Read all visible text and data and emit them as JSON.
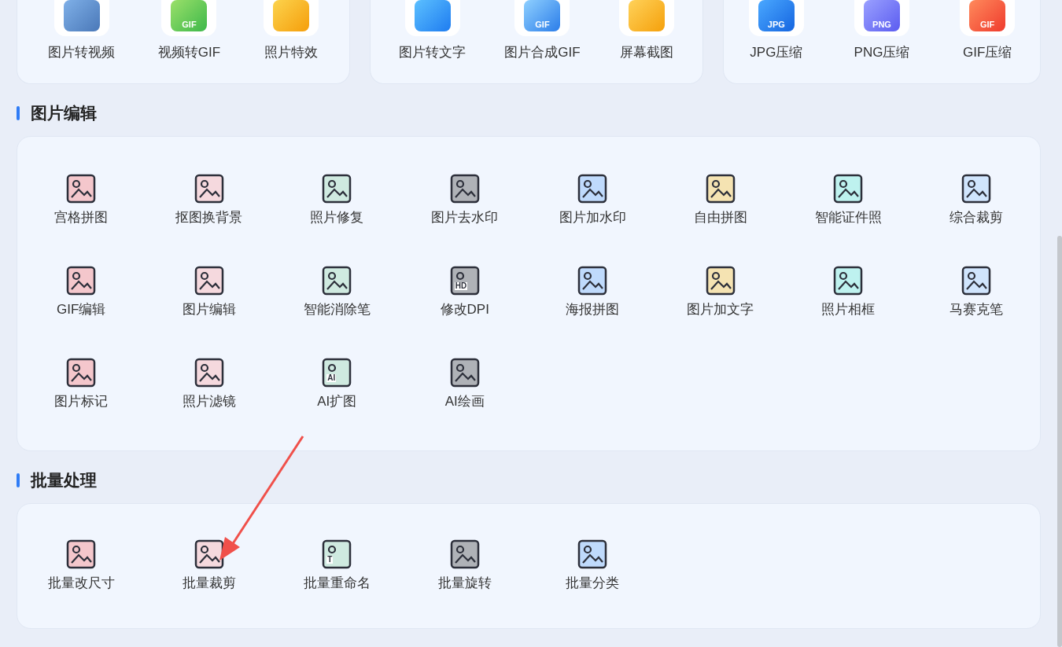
{
  "top_groups": [
    {
      "items": [
        {
          "label": "图片转视频"
        },
        {
          "label": "视频转GIF",
          "badge": "GIF"
        },
        {
          "label": "照片特效"
        }
      ]
    },
    {
      "items": [
        {
          "label": "图片转文字"
        },
        {
          "label": "图片合成GIF",
          "badge": "GIF"
        },
        {
          "label": "屏幕截图"
        }
      ]
    },
    {
      "items": [
        {
          "label": "JPG压缩",
          "badge": "JPG"
        },
        {
          "label": "PNG压缩",
          "badge": "PNG"
        },
        {
          "label": "GIF压缩",
          "badge": "GIF"
        }
      ]
    }
  ],
  "sections": [
    {
      "title": "图片编辑",
      "tools": [
        {
          "label": "宫格拼图"
        },
        {
          "label": "抠图换背景"
        },
        {
          "label": "照片修复"
        },
        {
          "label": "图片去水印"
        },
        {
          "label": "图片加水印"
        },
        {
          "label": "自由拼图"
        },
        {
          "label": "智能证件照"
        },
        {
          "label": "综合裁剪"
        },
        {
          "label": "GIF编辑"
        },
        {
          "label": "图片编辑"
        },
        {
          "label": "智能消除笔"
        },
        {
          "label": "修改DPI",
          "badge": "HD"
        },
        {
          "label": "海报拼图"
        },
        {
          "label": "图片加文字"
        },
        {
          "label": "照片相框"
        },
        {
          "label": "马赛克笔"
        },
        {
          "label": "图片标记"
        },
        {
          "label": "照片滤镜"
        },
        {
          "label": "AI扩图",
          "badge": "AI"
        },
        {
          "label": "AI绘画"
        }
      ]
    },
    {
      "title": "批量处理",
      "tools": [
        {
          "label": "批量改尺寸"
        },
        {
          "label": "批量裁剪"
        },
        {
          "label": "批量重命名",
          "badge": "T"
        },
        {
          "label": "批量旋转"
        },
        {
          "label": "批量分类"
        }
      ]
    }
  ]
}
